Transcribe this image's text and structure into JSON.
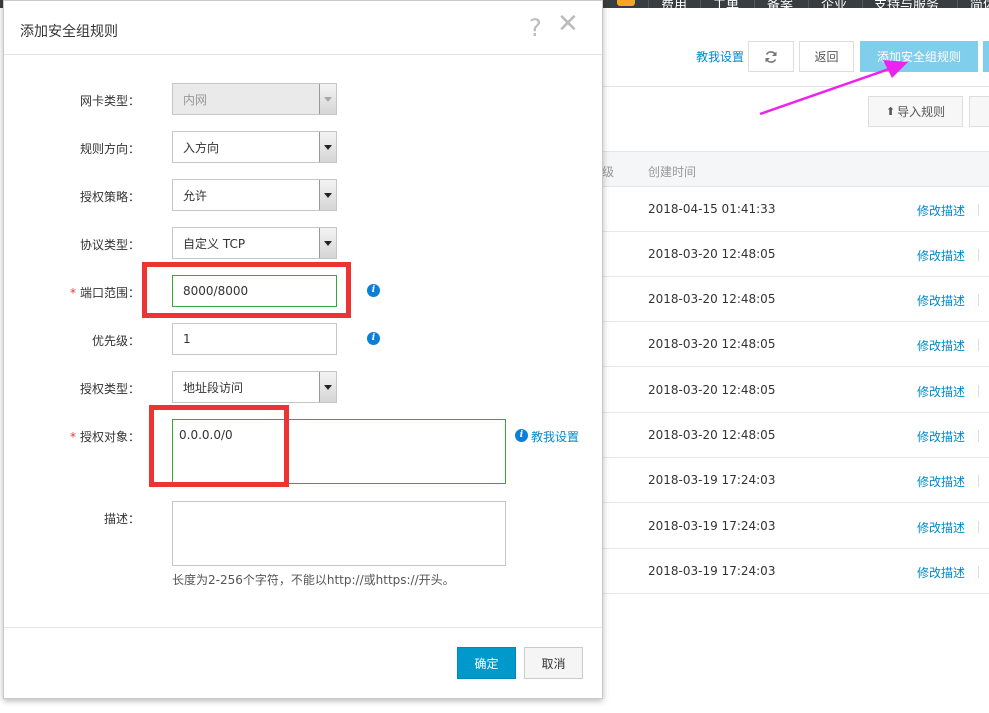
{
  "top_nav": {
    "items": [
      "费用",
      "工单",
      "备案",
      "企业",
      "支持与服务",
      "简体"
    ]
  },
  "toolbar": {
    "help_link": "教我设置",
    "back_label": "返回",
    "add_rule_label": "添加安全组规则",
    "import_label": "导入规则"
  },
  "table": {
    "header_partial": "级",
    "header_created": "创建时间",
    "rows": [
      {
        "time": "2018-04-15 01:41:33",
        "action": "修改描述"
      },
      {
        "time": "2018-03-20 12:48:05",
        "action": "修改描述"
      },
      {
        "time": "2018-03-20 12:48:05",
        "action": "修改描述"
      },
      {
        "time": "2018-03-20 12:48:05",
        "action": "修改描述"
      },
      {
        "time": "2018-03-20 12:48:05",
        "action": "修改描述"
      },
      {
        "time": "2018-03-20 12:48:05",
        "action": "修改描述"
      },
      {
        "time": "2018-03-19 17:24:03",
        "action": "修改描述"
      },
      {
        "time": "2018-03-19 17:24:03",
        "action": "修改描述"
      },
      {
        "time": "2018-03-19 17:24:03",
        "action": "修改描述"
      }
    ]
  },
  "dialog": {
    "title": "添加安全组规则",
    "help_glyph": "?",
    "close_glyph": "✕",
    "fields": {
      "nic_type": {
        "label": "网卡类型：",
        "value": "内网"
      },
      "direction": {
        "label": "规则方向：",
        "value": "入方向"
      },
      "policy": {
        "label": "授权策略：",
        "value": "允许"
      },
      "protocol": {
        "label": "协议类型：",
        "value": "自定义 TCP"
      },
      "port_range": {
        "label": "端口范围：",
        "value": "8000/8000"
      },
      "priority": {
        "label": "优先级：",
        "value": "1"
      },
      "auth_type": {
        "label": "授权类型：",
        "value": "地址段访问"
      },
      "auth_object": {
        "label": "授权对象：",
        "value": "0.0.0.0/0"
      },
      "description": {
        "label": "描述：",
        "value": ""
      }
    },
    "required_mark": "*",
    "info_glyph": "i",
    "teach_link": "教我设置",
    "desc_hint": "长度为2-256个字符，不能以http://或https://开头。",
    "confirm_label": "确定",
    "cancel_label": "取消"
  },
  "colors": {
    "annotation_red": "#ee3333",
    "annotation_arrow": "#ee22ee",
    "primary": "#0099cc"
  }
}
